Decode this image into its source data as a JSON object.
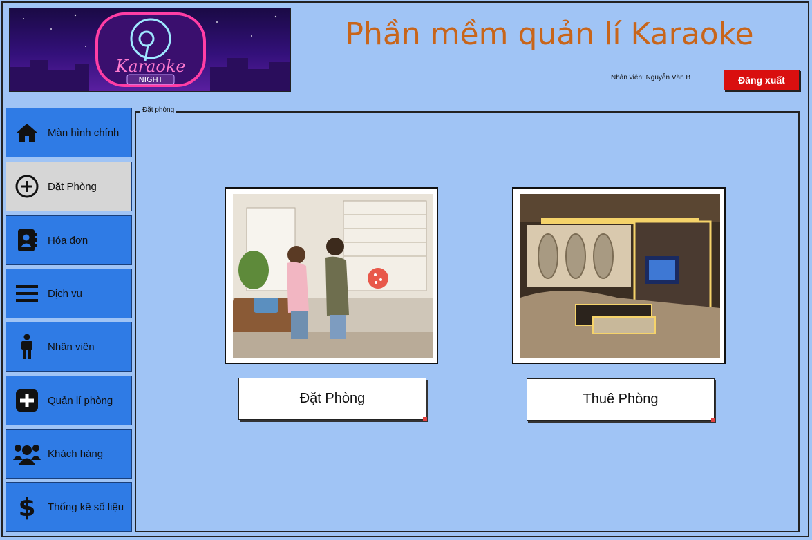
{
  "header": {
    "app_title": "Phần mềm quản lí Karaoke",
    "user_label": "Nhân viên: Nguyễn Văn B",
    "logout_label": "Đăng xuất",
    "logo": {
      "script_text": "Karaoke",
      "sub_text": "NIGHT"
    }
  },
  "sidebar": {
    "items": [
      {
        "label": "Màn hình chính",
        "icon": "home-icon"
      },
      {
        "label": "Đặt Phòng",
        "icon": "plus-circle-icon",
        "active": true
      },
      {
        "label": "Hóa đơn",
        "icon": "contact-book-icon"
      },
      {
        "label": "Dịch vụ",
        "icon": "menu-icon"
      },
      {
        "label": "Nhân viên",
        "icon": "person-icon"
      },
      {
        "label": "Quản lí phòng",
        "icon": "plus-square-icon"
      },
      {
        "label": "Khách hàng",
        "icon": "users-icon"
      },
      {
        "label": "Thống kê số liệu",
        "icon": "dollar-icon"
      }
    ]
  },
  "main": {
    "panel_title": "Đặt phòng",
    "actions": [
      {
        "label": "Đặt Phòng",
        "image": "girls-singing-photo"
      },
      {
        "label": "Thuê Phòng",
        "image": "karaoke-room-photo"
      }
    ]
  },
  "colors": {
    "background": "#a0c4f5",
    "sidebar": "#2f7be5",
    "sidebar_active": "#d6d6d6",
    "title": "#c8651a",
    "logout": "#d90f0f"
  }
}
